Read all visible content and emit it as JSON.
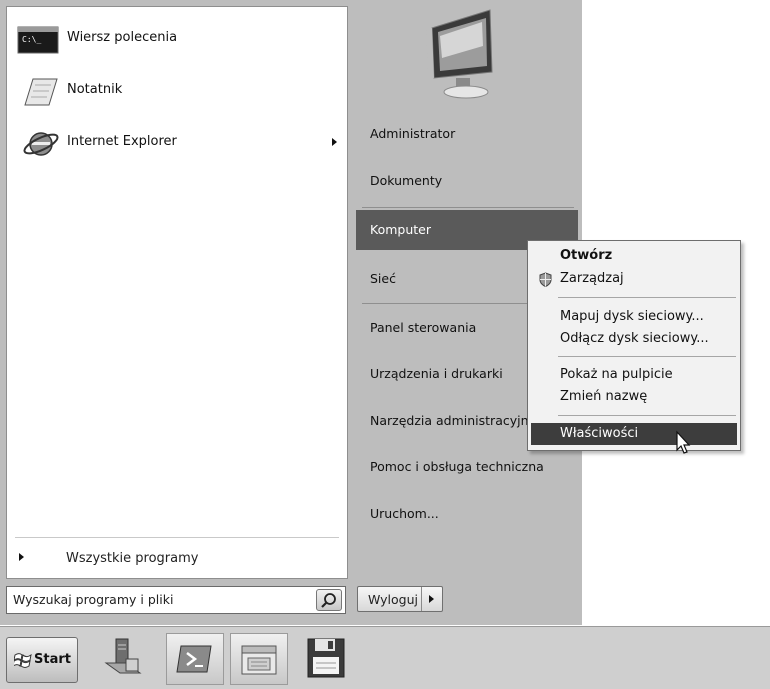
{
  "start_menu": {
    "programs": [
      {
        "label": "Wiersz polecenia",
        "icon": "command-prompt-icon"
      },
      {
        "label": "Notatnik",
        "icon": "notepad-icon"
      },
      {
        "label": "Internet Explorer",
        "icon": "internet-explorer-icon",
        "has_submenu": true
      }
    ],
    "all_programs_label": "Wszystkie programy",
    "search": {
      "value": "Wyszukaj programy i pliki",
      "button_icon": "search-icon"
    },
    "right_items": [
      {
        "label": "Administrator"
      },
      {
        "label": "Dokumenty"
      },
      {
        "label": "Komputer",
        "highlighted": true
      },
      {
        "label": "Sieć"
      },
      {
        "label": "Panel sterowania"
      },
      {
        "label": "Urządzenia i drukarki"
      },
      {
        "label": "Narzędzia administracyjne"
      },
      {
        "label": "Pomoc i obsługa techniczna"
      },
      {
        "label": "Uruchom..."
      }
    ],
    "logoff_label": "Wyloguj",
    "user_picture_icon": "monitor-icon"
  },
  "context_menu": {
    "items": [
      {
        "label": "Otwórz",
        "bold": true
      },
      {
        "label": "Zarządzaj",
        "icon": "uac-shield-icon"
      },
      {
        "label": "Mapuj dysk sieciowy..."
      },
      {
        "label": "Odłącz dysk sieciowy..."
      },
      {
        "label": "Pokaż na pulpicie"
      },
      {
        "label": "Zmień nazwę"
      },
      {
        "label": "Właściwości",
        "highlighted": true
      }
    ]
  },
  "taskbar": {
    "start_label": "Start",
    "pinned": [
      {
        "icon": "server-manager-icon"
      },
      {
        "icon": "powershell-icon"
      },
      {
        "icon": "explorer-icon"
      },
      {
        "icon": "floppy-disk-icon"
      }
    ]
  },
  "colors": {
    "menu_frame": "#bdbdbd",
    "highlight": "#5a5a5a",
    "context_highlight": "#3d3d3d"
  }
}
